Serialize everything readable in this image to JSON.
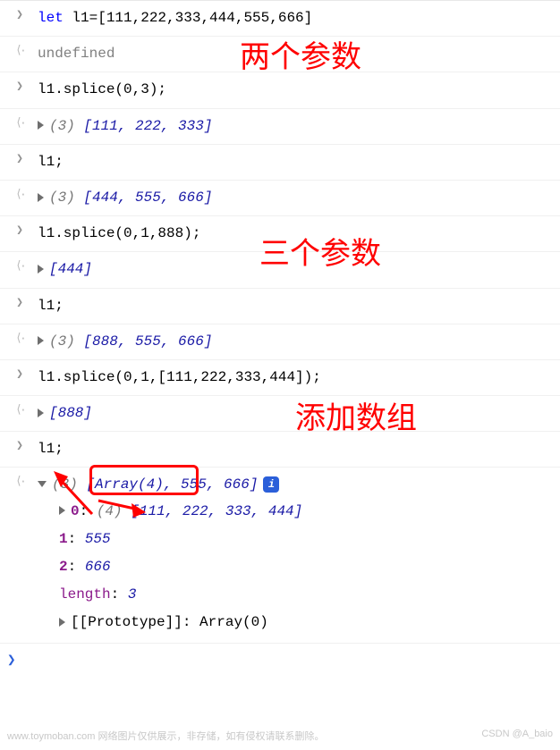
{
  "annotations": {
    "a1": "两个参数",
    "a2": "三个参数",
    "a3": "添加数组"
  },
  "rows": {
    "r1": {
      "kw": "let",
      "rest": " l1=[111,222,333,444,555,666]"
    },
    "r2": "undefined",
    "r3": "l1.splice(0,3);",
    "r4": {
      "count": "(3)",
      "arr": " [111, 222, 333]"
    },
    "r5": "l1;",
    "r6": {
      "count": "(3)",
      "arr": " [444, 555, 666]"
    },
    "r7": "l1.splice(0,1,888);",
    "r8": {
      "arr": "[444]"
    },
    "r9": "l1;",
    "r10": {
      "count": "(3)",
      "arr": " [888, 555, 666]"
    },
    "r11": "l1.splice(0,1,[111,222,333,444]);",
    "r12": {
      "arr": "[888]"
    },
    "r13": "l1;",
    "expanded": {
      "head_count": "(3)",
      "head_arr": " [Array(4), 555, 666]",
      "line0_key": "0",
      "line0_count": "(4)",
      "line0_arr": " [111, 222, 333, 444]",
      "line1_key": "1",
      "line1_val": "555",
      "line2_key": "2",
      "line2_val": "666",
      "len_key": "length",
      "len_val": "3",
      "proto": "[[Prototype]]",
      "proto_val": ": Array(0)"
    }
  },
  "badge": "i",
  "prompt": "❯",
  "watermark_left": "www.toymoban.com  网络图片仅供展示，非存储，如有侵权请联系删除。",
  "watermark_right": "CSDN @A_baio"
}
